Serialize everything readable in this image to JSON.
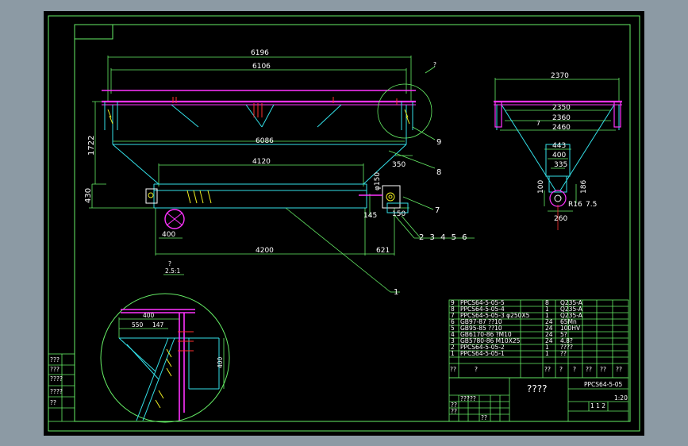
{
  "colors": {
    "background": "#000000",
    "frame": "#66ee66",
    "cyan": "#33e0e8",
    "magenta": "#ff33ff",
    "yellow": "#eeee22",
    "white": "#ffffff",
    "red": "#ff3030"
  },
  "main_view": {
    "dims": {
      "d6196": "6196",
      "d6106": "6106",
      "d6086": "6086",
      "d4120": "4120",
      "d4200": "4200",
      "d1722": "1722",
      "d430": "430",
      "d400": "400",
      "d621": "621",
      "d145": "145",
      "d150": "150",
      "d350": "350",
      "phi150": "φ150"
    },
    "callouts": {
      "c1": "1",
      "c7": "7",
      "c8": "8",
      "c9": "9",
      "c2to6": "2 3 4 5 6",
      "q_top": "?"
    }
  },
  "side_view": {
    "dims": {
      "d2370": "2370",
      "d2350": "2350",
      "d2360": "2360",
      "d2460": "2460",
      "d443": "443",
      "d400": "400",
      "d335": "335",
      "d100": "100",
      "d186": "186",
      "r16": "R16",
      "d75": "7.5",
      "d260": "260",
      "d7": "7"
    }
  },
  "detail": {
    "label_q": "?",
    "scale": "2.5:1",
    "d400_top": "400",
    "d550": "550",
    "d147": "147",
    "d400_side": "400"
  },
  "bom": {
    "rows": [
      {
        "no": "9",
        "code": "PPCS64-5-05-5",
        "qty": "8",
        "material": "Q235-A"
      },
      {
        "no": "8",
        "code": "PPCS64-5-05-4",
        "qty": "1",
        "material": "Q235-A"
      },
      {
        "no": "7",
        "code": "PPCS64-5-05-3 φ250X5",
        "qty": "1",
        "material": "Q235-A"
      },
      {
        "no": "6",
        "code": "GB97-87  ??10",
        "qty": "24",
        "material": "65Mn"
      },
      {
        "no": "5",
        "code": "GB95-85  ??10",
        "qty": "24",
        "material": "100HV"
      },
      {
        "no": "4",
        "code": "GB6170-86 ?M10",
        "qty": "24",
        "material": "5?"
      },
      {
        "no": "3",
        "code": "GB5780-86 M10X25",
        "qty": "24",
        "material": "4.8?"
      },
      {
        "no": "2",
        "code": "PPCS64-5-05-2",
        "qty": "1",
        "material": "????"
      },
      {
        "no": "1",
        "code": "PPCS64-5-05-1",
        "qty": "1",
        "material": "??"
      }
    ],
    "header": {
      "no": "??",
      "code": "?",
      "qty": "??",
      "a": "?",
      "b": "?",
      "c": "??",
      "d": "??",
      "e": "??"
    }
  },
  "title_block": {
    "name": "????",
    "drawing_no": "PPCS64-5-05",
    "scale": "1:20",
    "sheet": "1  1  2",
    "small_marks": [
      "?????",
      "??",
      "??",
      "??"
    ]
  },
  "left_strip": [
    "???",
    "???",
    "????",
    "????",
    "??"
  ]
}
